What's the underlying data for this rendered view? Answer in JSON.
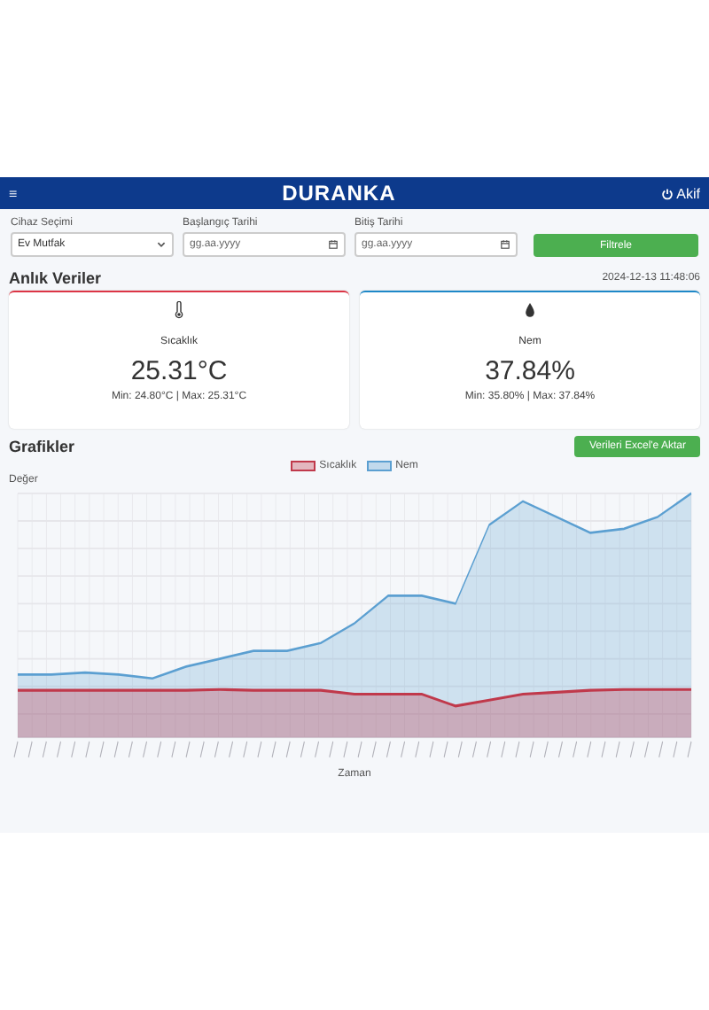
{
  "navbar": {
    "menu_icon": "≡",
    "brand": "DURANKA",
    "user": "Akif"
  },
  "filters": [
    {
      "kind": "select",
      "label": "Cihaz Seçimi",
      "value": "Ev Mutfak"
    },
    {
      "kind": "date",
      "label": "Başlangıç Tarihi",
      "placeholder": "gg.aa.yyyy"
    },
    {
      "kind": "date",
      "label": "Bitiş Tarihi",
      "placeholder": "gg.aa.yyyy"
    }
  ],
  "filter_button": "Filtrele",
  "live": {
    "title": "Anlık Veriler",
    "timestamp": "2024-12-13 11:48:06"
  },
  "cards": [
    {
      "kind": "temperature",
      "color": "#dc3545",
      "label": "Sıcaklık",
      "value": "25.31°C",
      "range": "Min: 24.80°C | Max: 25.31°C"
    },
    {
      "kind": "humidity",
      "color": "#1e88c8",
      "label": "Nem",
      "value": "37.84%",
      "range": "Min: 35.80% | Max: 37.84%"
    }
  ],
  "charts": {
    "title": "Grafikler",
    "export_button": "Verileri Excel'e Aktar",
    "legend": [
      {
        "name": "Sıcaklık",
        "color": "#c0394b"
      },
      {
        "name": "Nem",
        "color": "#5b9fd1"
      }
    ],
    "ylabel": "Değer",
    "xlabel": "Zaman"
  }
}
